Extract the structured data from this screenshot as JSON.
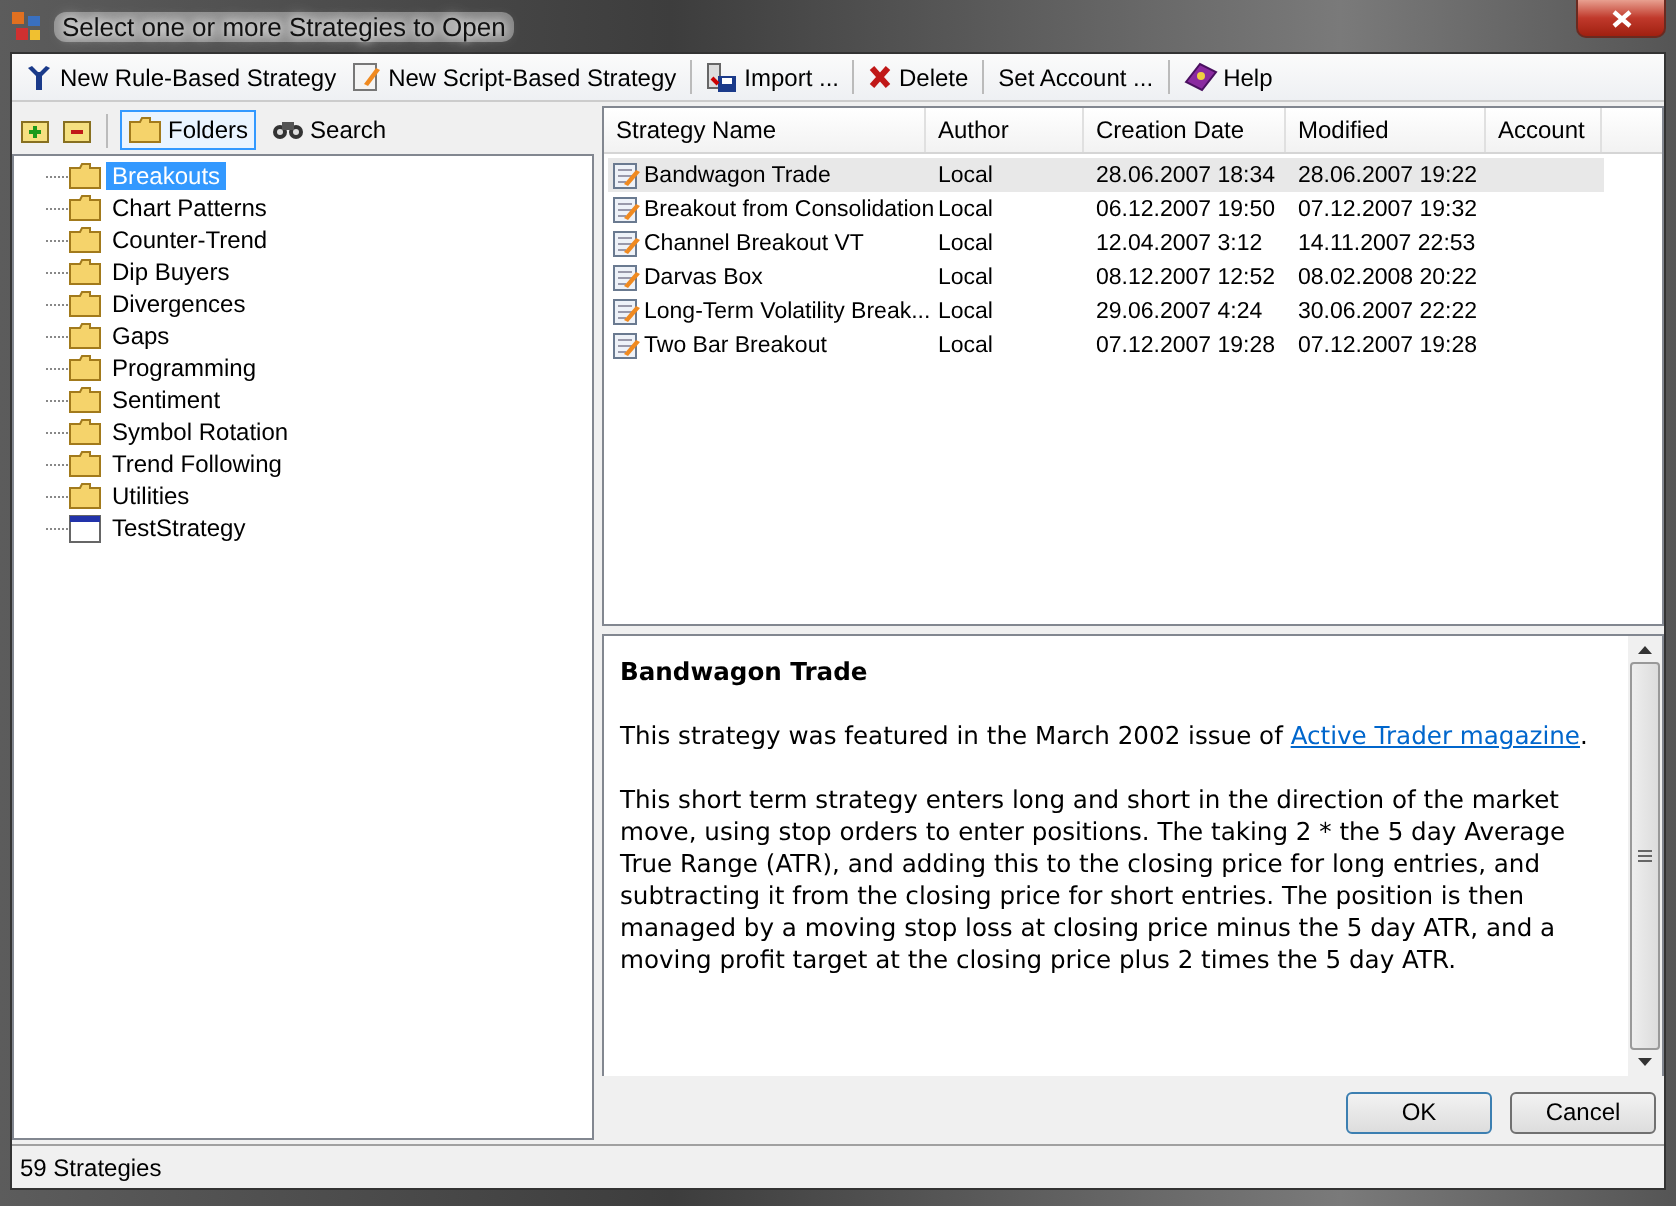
{
  "window": {
    "title": "Select one or more Strategies to Open"
  },
  "toolbar": [
    {
      "label": "New Rule-Based Strategy"
    },
    {
      "label": "New Script-Based Strategy"
    },
    {
      "label": "Import ..."
    },
    {
      "label": "Delete"
    },
    {
      "label": "Set Account ..."
    },
    {
      "label": "Help"
    }
  ],
  "left_tabs": [
    {
      "label": "Folders",
      "selected": true
    },
    {
      "label": "Search",
      "selected": false
    }
  ],
  "tree": [
    {
      "label": "Breakouts",
      "kind": "folder",
      "selected": true
    },
    {
      "label": "Chart Patterns",
      "kind": "folder",
      "selected": false
    },
    {
      "label": "Counter-Trend",
      "kind": "folder",
      "selected": false
    },
    {
      "label": "Dip Buyers",
      "kind": "folder",
      "selected": false
    },
    {
      "label": "Divergences",
      "kind": "folder",
      "selected": false
    },
    {
      "label": "Gaps",
      "kind": "folder",
      "selected": false
    },
    {
      "label": "Programming",
      "kind": "folder",
      "selected": false
    },
    {
      "label": "Sentiment",
      "kind": "folder",
      "selected": false
    },
    {
      "label": "Symbol Rotation",
      "kind": "folder",
      "selected": false
    },
    {
      "label": "Trend Following",
      "kind": "folder",
      "selected": false
    },
    {
      "label": "Utilities",
      "kind": "folder",
      "selected": false
    },
    {
      "label": "TestStrategy",
      "kind": "strategy",
      "selected": false
    }
  ],
  "table": {
    "columns": [
      "Strategy Name",
      "Author",
      "Creation Date",
      "Modified",
      "Account"
    ],
    "rows": [
      {
        "cells": [
          "Bandwagon Trade",
          "Local",
          "28.06.2007 18:34",
          "28.06.2007 19:22"
        ],
        "selected": true
      },
      {
        "cells": [
          "Breakout from Consolidation",
          "Local",
          "06.12.2007 19:50",
          "07.12.2007 19:32"
        ],
        "selected": false
      },
      {
        "cells": [
          "Channel Breakout VT",
          "Local",
          "12.04.2007 3:12",
          "14.11.2007 22:53"
        ],
        "selected": false
      },
      {
        "cells": [
          "Darvas Box",
          "Local",
          "08.12.2007 12:52",
          "08.02.2008 20:22"
        ],
        "selected": false
      },
      {
        "cells": [
          "Long-Term Volatility Break...",
          "Local",
          "29.06.2007 4:24",
          "30.06.2007 22:22"
        ],
        "selected": false
      },
      {
        "cells": [
          "Two Bar Breakout",
          "Local",
          "07.12.2007 19:28",
          "07.12.2007 19:28"
        ],
        "selected": false
      }
    ]
  },
  "description": {
    "title": "Bandwagon Trade",
    "intro": {
      "before": "This strategy was featured in the March 2002 issue of ",
      "link": "Active Trader magazine",
      "after": "."
    },
    "body": "This short term strategy enters long and short in the direction of the market move, using stop orders to enter positions.  The taking 2 * the 5 day Average True Range (ATR), and adding this to the closing price for long entries, and subtracting it from the closing price for short entries. The position is then managed by a moving stop loss at closing price minus the 5 day ATR, and a moving profit target at the closing price plus 2 times the 5 day ATR."
  },
  "buttons": [
    "OK",
    "Cancel"
  ],
  "status_bar": "59 Strategies"
}
